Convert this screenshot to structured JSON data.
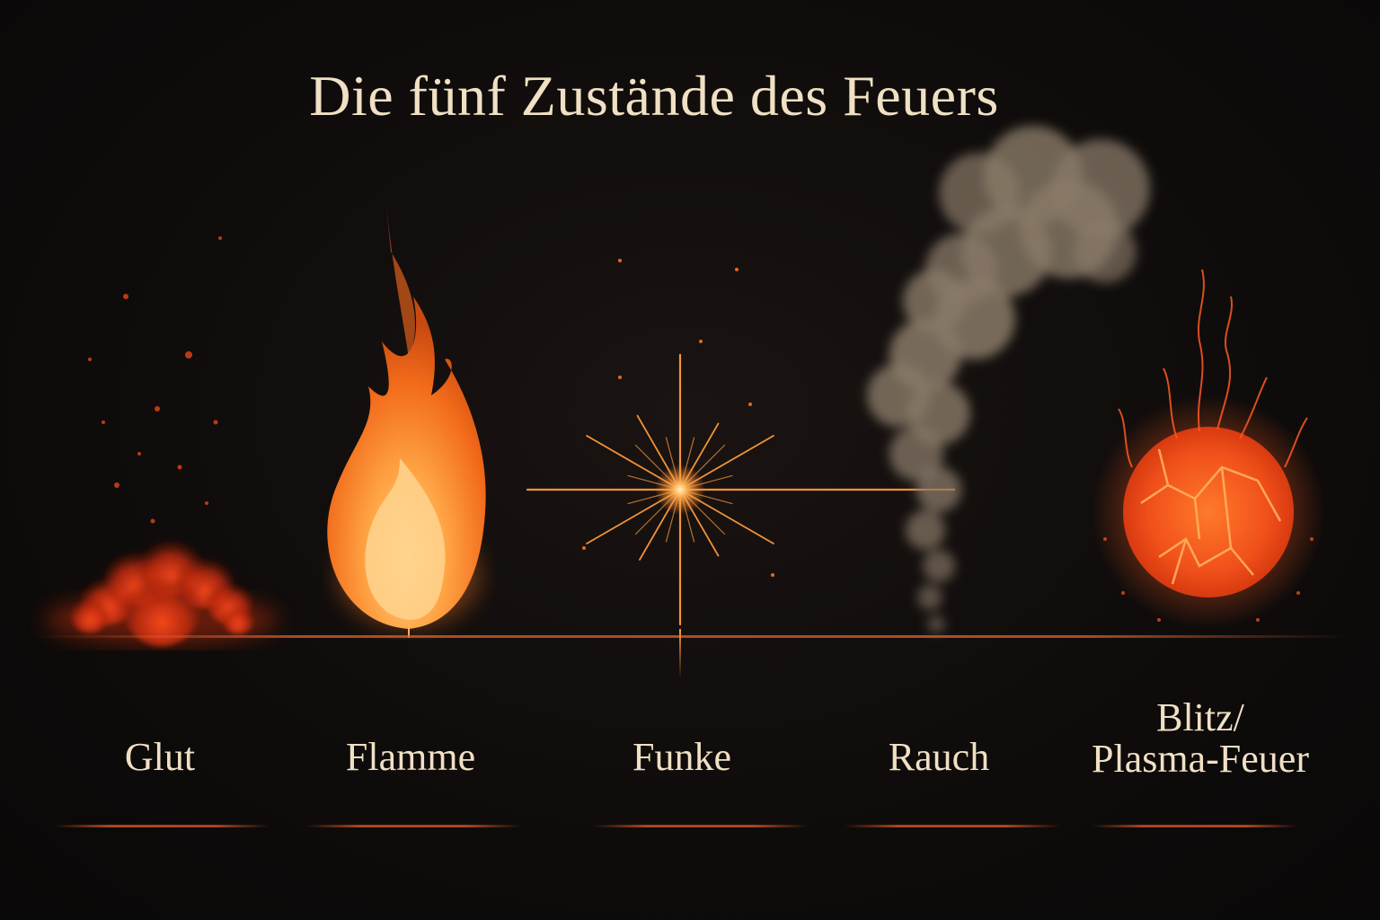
{
  "title": "Die fünf Zustände des Feuers",
  "states": [
    {
      "label": "Glut"
    },
    {
      "label": "Flamme"
    },
    {
      "label": "Funke"
    },
    {
      "label": "Rauch"
    },
    {
      "label_line1": "Blitz/",
      "label_line2": "Plasma-Feuer"
    }
  ],
  "colors": {
    "background": "#0f0c0b",
    "text": "#f0e0c4",
    "ember": "#d83a14",
    "flame": "#ff8a2a",
    "spark": "#ff9a3a",
    "smoke": "#8a7a68",
    "plasma": "#ff5a1e"
  }
}
